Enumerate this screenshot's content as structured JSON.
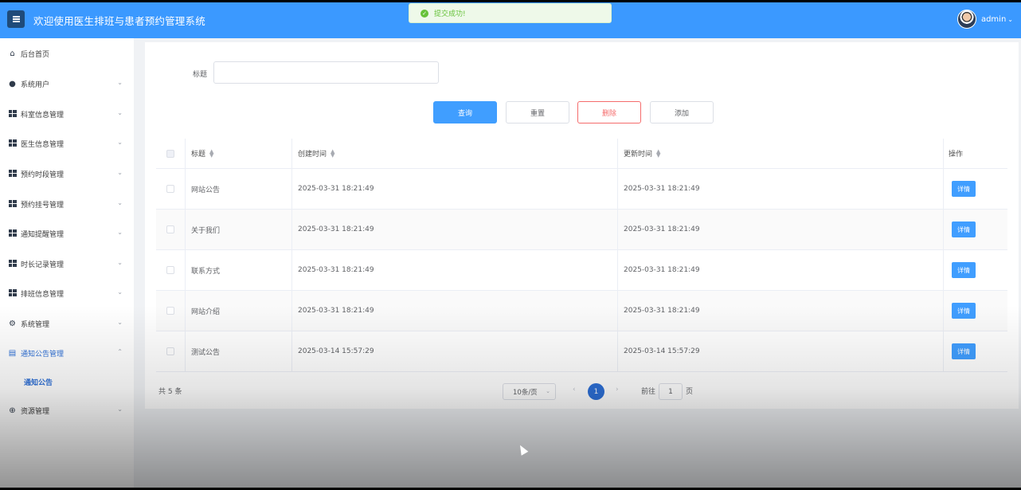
{
  "header": {
    "title": "欢迎使用医生排班与患者预约管理系统",
    "toast": "提交成功!",
    "user": "admin"
  },
  "sidebar": {
    "items": [
      {
        "label": "后台首页",
        "icon": "home-icon"
      },
      {
        "label": "系统用户",
        "icon": "user-icon"
      },
      {
        "label": "科室信息管理",
        "icon": "grid-icon"
      },
      {
        "label": "医生信息管理",
        "icon": "grid-icon"
      },
      {
        "label": "预约时段管理",
        "icon": "grid-icon"
      },
      {
        "label": "预约挂号管理",
        "icon": "grid-icon"
      },
      {
        "label": "通知提醒管理",
        "icon": "grid-icon"
      },
      {
        "label": "时长记录管理",
        "icon": "grid-icon"
      },
      {
        "label": "排班信息管理",
        "icon": "grid-icon"
      },
      {
        "label": "系统管理",
        "icon": "gear-icon"
      },
      {
        "label": "通知公告管理",
        "icon": "document-icon"
      },
      {
        "label": "资源管理",
        "icon": "plus-circle-icon"
      }
    ],
    "sub_item": "通知公告"
  },
  "search": {
    "label": "标题",
    "value": ""
  },
  "buttons": {
    "query": "查询",
    "reset": "重置",
    "delete": "删除",
    "add": "添加"
  },
  "table": {
    "headers": [
      "标题",
      "创建时间",
      "更新时间",
      "操作"
    ],
    "rows": [
      {
        "title": "网站公告",
        "created": "2025-03-31 18:21:49",
        "updated": "2025-03-31 18:21:49"
      },
      {
        "title": "关于我们",
        "created": "2025-03-31 18:21:49",
        "updated": "2025-03-31 18:21:49"
      },
      {
        "title": "联系方式",
        "created": "2025-03-31 18:21:49",
        "updated": "2025-03-31 18:21:49"
      },
      {
        "title": "网站介绍",
        "created": "2025-03-31 18:21:49",
        "updated": "2025-03-31 18:21:49"
      },
      {
        "title": "测试公告",
        "created": "2025-03-14 15:57:29",
        "updated": "2025-03-14 15:57:29"
      }
    ],
    "detail_label": "详情"
  },
  "pagination": {
    "total": "共 5 条",
    "page_size": "10条/页",
    "current_page": "1",
    "goto_label": "前往",
    "goto_value": "1",
    "page_unit": "页"
  },
  "colors": {
    "header": "#3b99ff",
    "primary": "#409eff",
    "danger": "#f56c6c",
    "success": "#67c23a"
  }
}
